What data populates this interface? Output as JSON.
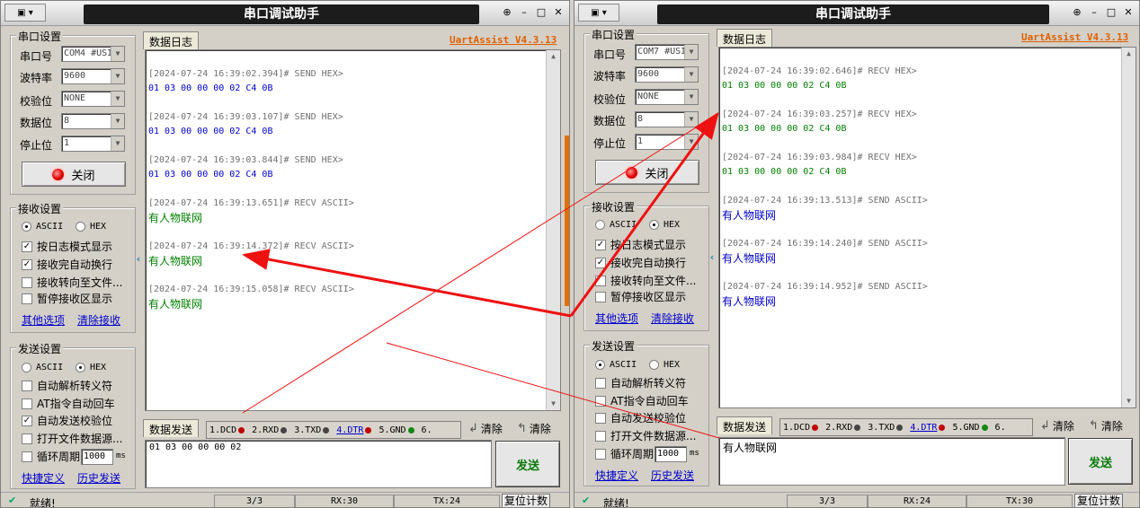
{
  "left": {
    "title": "串口调试助手",
    "brand": "UartAssist V4.3.13",
    "port": {
      "group_title": "串口设置",
      "fields": [
        {
          "label": "串口号",
          "value": "COM4 #USI"
        },
        {
          "label": "波特率",
          "value": "9600"
        },
        {
          "label": "校验位",
          "value": "NONE"
        },
        {
          "label": "数据位",
          "value": "8"
        },
        {
          "label": "停止位",
          "value": "1"
        }
      ],
      "open_button": "关闭"
    },
    "recv": {
      "group_title": "接收设置",
      "ascii": "ASCII",
      "hex": "HEX",
      "selected": "ASCII",
      "checks": [
        {
          "label": "按日志模式显示",
          "checked": true
        },
        {
          "label": "接收完自动换行",
          "checked": true
        },
        {
          "label": "接收转向至文件...",
          "checked": false
        },
        {
          "label": "暂停接收区显示",
          "checked": false
        }
      ],
      "link1": "其他选项",
      "link2": "清除接收"
    },
    "send": {
      "group_title": "发送设置",
      "ascii": "ASCII",
      "hex": "HEX",
      "selected": "HEX",
      "checks": [
        {
          "label": "自动解析转义符",
          "checked": false
        },
        {
          "label": "AT指令自动回车",
          "checked": false
        },
        {
          "label": "自动发送校验位",
          "checked": true
        },
        {
          "label": "打开文件数据源...",
          "checked": false
        }
      ],
      "cycle_label": "循环周期",
      "cycle_value": "1000",
      "cycle_unit": "ms",
      "link1": "快捷定义",
      "link2": "历史发送"
    },
    "log_tab": "数据日志",
    "log": [
      {
        "header": "[2024-07-24 16:39:02.394]# SEND HEX>",
        "data": "01 03 00 00 00 02 C4 0B",
        "kind": "send"
      },
      {
        "header": "[2024-07-24 16:39:03.107]# SEND HEX>",
        "data": "01 03 00 00 00 02 C4 0B",
        "kind": "send"
      },
      {
        "header": "[2024-07-24 16:39:03.844]# SEND HEX>",
        "data": "01 03 00 00 00 02 C4 0B",
        "kind": "send"
      },
      {
        "header": "[2024-07-24 16:39:13.651]# RECV ASCII>",
        "data": "有人物联网",
        "kind": "recv"
      },
      {
        "header": "[2024-07-24 16:39:14.372]# RECV ASCII>",
        "data": "有人物联网",
        "kind": "recv"
      },
      {
        "header": "[2024-07-24 16:39:15.058]# RECV ASCII>",
        "data": "有人物联网",
        "kind": "recv"
      }
    ],
    "send_tab": "数据发送",
    "signals": [
      "1.DCD",
      "2.RXD",
      "3.TXD",
      "4.DTR",
      "5.GND",
      "6."
    ],
    "clear1": "清除",
    "clear2": "清除",
    "send_text": "01 03 00 00 00 02",
    "send_button": "发送",
    "status": {
      "ready": "就绪!",
      "frames": "3/3",
      "rx": "RX:30",
      "tx": "TX:24",
      "reset": "复位计数"
    }
  },
  "right": {
    "title": "串口调试助手",
    "brand": "UartAssist V4.3.13",
    "port": {
      "group_title": "串口设置",
      "fields": [
        {
          "label": "串口号",
          "value": "COM7 #USI"
        },
        {
          "label": "波特率",
          "value": "9600"
        },
        {
          "label": "校验位",
          "value": "NONE"
        },
        {
          "label": "数据位",
          "value": "8"
        },
        {
          "label": "停止位",
          "value": "1"
        }
      ],
      "open_button": "关闭"
    },
    "recv": {
      "group_title": "接收设置",
      "ascii": "ASCII",
      "hex": "HEX",
      "selected": "HEX",
      "checks": [
        {
          "label": "按日志模式显示",
          "checked": true
        },
        {
          "label": "接收完自动换行",
          "checked": true
        },
        {
          "label": "接收转向至文件...",
          "checked": false
        },
        {
          "label": "暂停接收区显示",
          "checked": false
        }
      ],
      "link1": "其他选项",
      "link2": "清除接收"
    },
    "send": {
      "group_title": "发送设置",
      "ascii": "ASCII",
      "hex": "HEX",
      "selected": "ASCII",
      "checks": [
        {
          "label": "自动解析转义符",
          "checked": false
        },
        {
          "label": "AT指令自动回车",
          "checked": false
        },
        {
          "label": "自动发送校验位",
          "checked": false
        },
        {
          "label": "打开文件数据源...",
          "checked": false
        }
      ],
      "cycle_label": "循环周期",
      "cycle_value": "1000",
      "cycle_unit": "ms",
      "link1": "快捷定义",
      "link2": "历史发送"
    },
    "log_tab": "数据日志",
    "log": [
      {
        "header": "[2024-07-24 16:39:02.646]# RECV HEX>",
        "data": "01 03 00 00 00 02 C4 0B",
        "kind": "recv"
      },
      {
        "header": "[2024-07-24 16:39:03.257]# RECV HEX>",
        "data": "01 03 00 00 00 02 C4 0B",
        "kind": "recv"
      },
      {
        "header": "[2024-07-24 16:39:03.984]# RECV HEX>",
        "data": "01 03 00 00 00 02 C4 0B",
        "kind": "recv"
      },
      {
        "header": "[2024-07-24 16:39:13.513]# SEND ASCII>",
        "data": "有人物联网",
        "kind": "send"
      },
      {
        "header": "[2024-07-24 16:39:14.240]# SEND ASCII>",
        "data": "有人物联网",
        "kind": "send"
      },
      {
        "header": "[2024-07-24 16:39:14.952]# SEND ASCII>",
        "data": "有人物联网",
        "kind": "send"
      }
    ],
    "send_tab": "数据发送",
    "signals": [
      "1.DCD",
      "2.RXD",
      "3.TXD",
      "4.DTR",
      "5.GND",
      "6."
    ],
    "clear1": "清除",
    "clear2": "清除",
    "send_text": "有人物联网",
    "send_button": "发送",
    "status": {
      "ready": "就绪!",
      "frames": "3/3",
      "rx": "RX:24",
      "tx": "TX:30",
      "reset": "复位计数"
    }
  },
  "colors": {
    "send_text": "#0000cc",
    "recv_text": "#008000",
    "brand": "#e06000",
    "arrow": "#ee1111"
  }
}
